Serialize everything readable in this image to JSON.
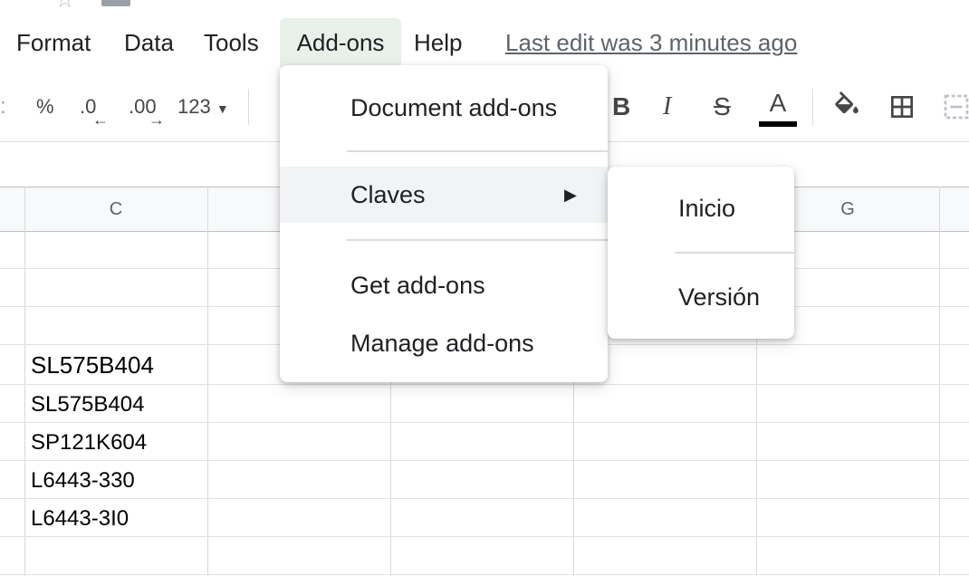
{
  "menubar": {
    "items": [
      "Format",
      "Data",
      "Tools",
      "Add-ons",
      "Help"
    ],
    "last_edit": "Last edit was 3 minutes ago"
  },
  "toolbar": {
    "percent": "%",
    "decrease_decimal": ".0",
    "increase_decimal": ".00",
    "more_formats": "123",
    "bold": "B",
    "italic": "I",
    "strikethrough": "S",
    "text_color": "A"
  },
  "grid": {
    "columns": [
      "C",
      "G"
    ],
    "cells": [
      "SL575B404",
      "SL575B404",
      "SP121K604",
      "L6443-330",
      "L6443-3I0"
    ]
  },
  "addons_menu": {
    "items": [
      "Document add-ons",
      "Claves",
      "Get add-ons",
      "Manage add-ons"
    ],
    "highlighted": "Claves"
  },
  "claves_submenu": {
    "items": [
      "Inicio",
      "Versión"
    ]
  },
  "colors": {
    "active_menu_bg": "#e8f0ea",
    "highlight_bg": "#f1f3f4",
    "text_color_bar": "#000000"
  }
}
